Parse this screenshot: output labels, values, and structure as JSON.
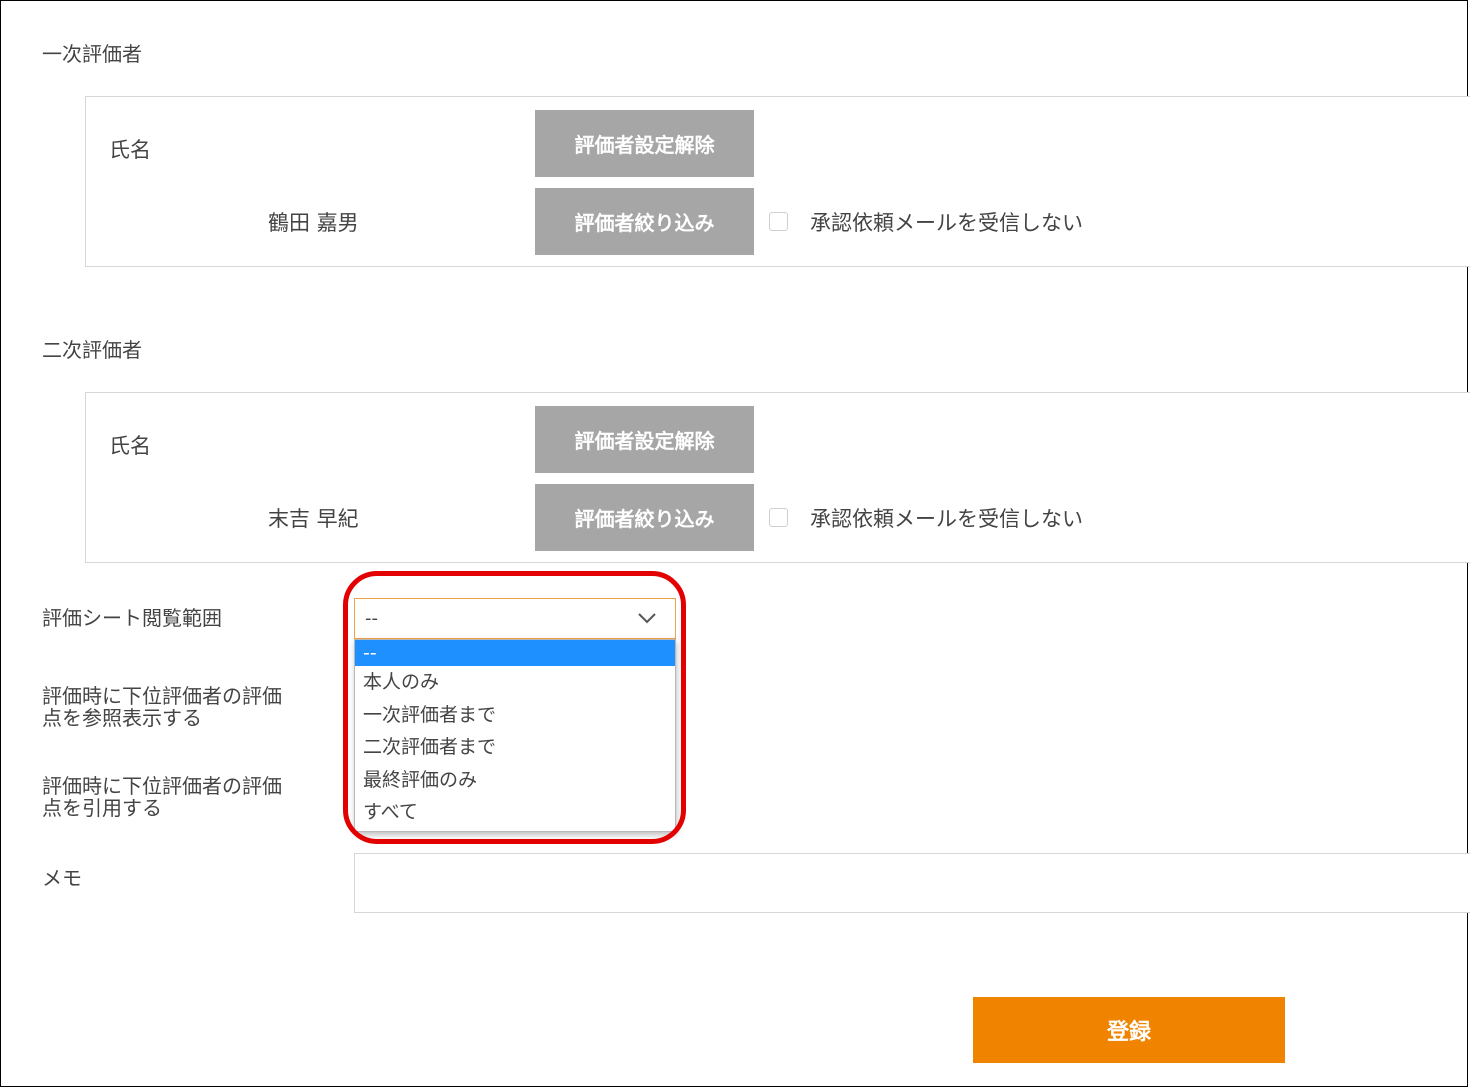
{
  "first_evaluator": {
    "section_title": "一次評価者",
    "name_label": "氏名",
    "person_name": "鶴田 嘉男",
    "unset_button": "評価者設定解除",
    "filter_button": "評価者絞り込み",
    "checkbox_label": "承認依頼メールを受信しない",
    "checkbox_checked": false
  },
  "second_evaluator": {
    "section_title": "二次評価者",
    "name_label": "氏名",
    "person_name": "末吉 早紀",
    "unset_button": "評価者設定解除",
    "filter_button": "評価者絞り込み",
    "checkbox_label": "承認依頼メールを受信しない",
    "checkbox_checked": false
  },
  "view_scope": {
    "label": "評価シート閲覧範囲",
    "selected_value": "--",
    "options": [
      "--",
      "本人のみ",
      "一次評価者まで",
      "二次評価者まで",
      "最終評価のみ",
      "すべて"
    ],
    "selected_index": 0
  },
  "reference_display": {
    "label_line1": "評価時に下位評価者の評価",
    "label_line2": "点を参照表示する"
  },
  "quote_scores": {
    "label_line1": "評価時に下位評価者の評価",
    "label_line2": "点を引用する"
  },
  "memo": {
    "label": "メモ",
    "value": ""
  },
  "submit": {
    "label": "登録"
  },
  "colors": {
    "gray_button": "#a6a6a6",
    "submit_button": "#f08300",
    "select_border": "#f0a24a",
    "selected_option": "#1e90ff",
    "highlight_ring": "#e30000"
  }
}
